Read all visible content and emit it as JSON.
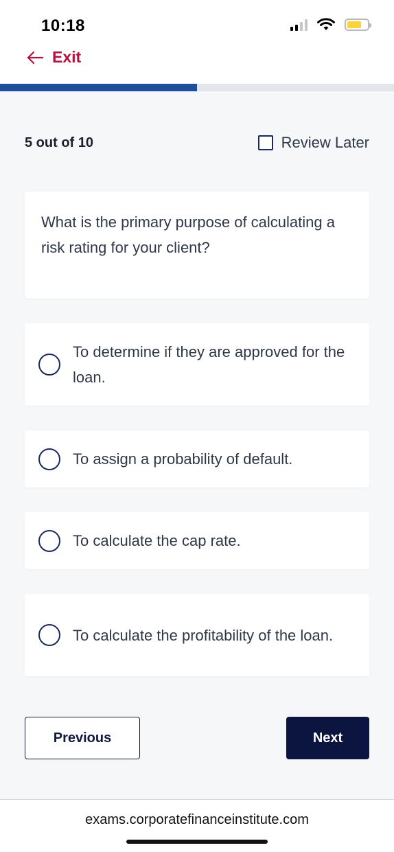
{
  "status_bar": {
    "time": "10:18",
    "icons": [
      "signal-icon",
      "wifi-icon",
      "battery-icon"
    ]
  },
  "header": {
    "exit_label": "Exit",
    "exit_icon": "arrow-left-icon",
    "accent_color": "#b0133f"
  },
  "progress": {
    "fraction": 0.5,
    "color": "#1f4f9c"
  },
  "quiz": {
    "counter": "5 out of 10",
    "review_later_label": "Review Later",
    "question": "What is the primary purpose of calculating a risk rating for your client?",
    "options": [
      {
        "label": "To determine if they are approved for the loan."
      },
      {
        "label": "To assign a probability of default."
      },
      {
        "label": "To calculate the cap rate."
      },
      {
        "label": "To calculate the profitability of the loan."
      }
    ]
  },
  "navigation": {
    "previous_label": "Previous",
    "next_label": "Next"
  },
  "browser": {
    "url": "exams.corporatefinanceinstitute.com"
  }
}
